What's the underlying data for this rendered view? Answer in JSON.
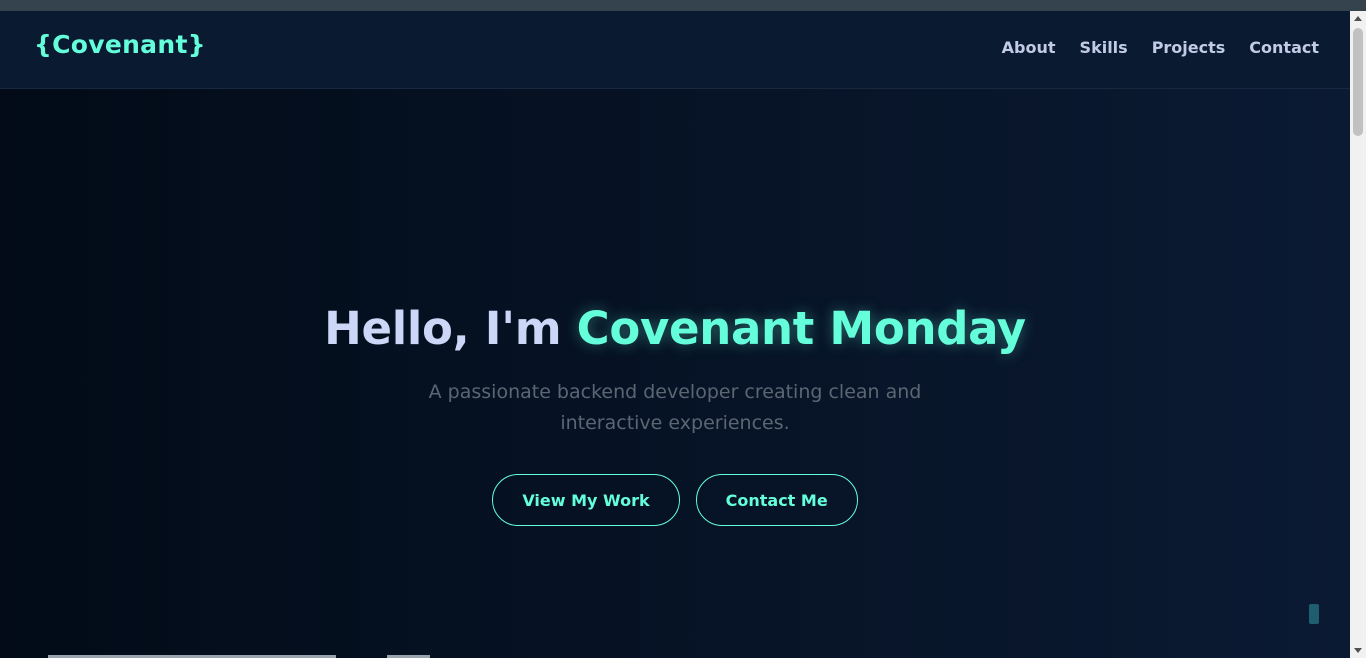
{
  "navbar": {
    "logo": "{Covenant}",
    "links": [
      {
        "label": "About"
      },
      {
        "label": "Skills"
      },
      {
        "label": "Projects"
      },
      {
        "label": "Contact"
      }
    ]
  },
  "hero": {
    "greeting": "Hello, I'm ",
    "name": "Covenant Monday",
    "subtitle": "A passionate backend developer creating clean and interactive experiences.",
    "primary_button": "View My Work",
    "secondary_button": "Contact Me"
  },
  "colors": {
    "accent": "#64ffda",
    "background": "#0a192f",
    "heading": "#ccd6f6",
    "muted": "#5c6672"
  }
}
